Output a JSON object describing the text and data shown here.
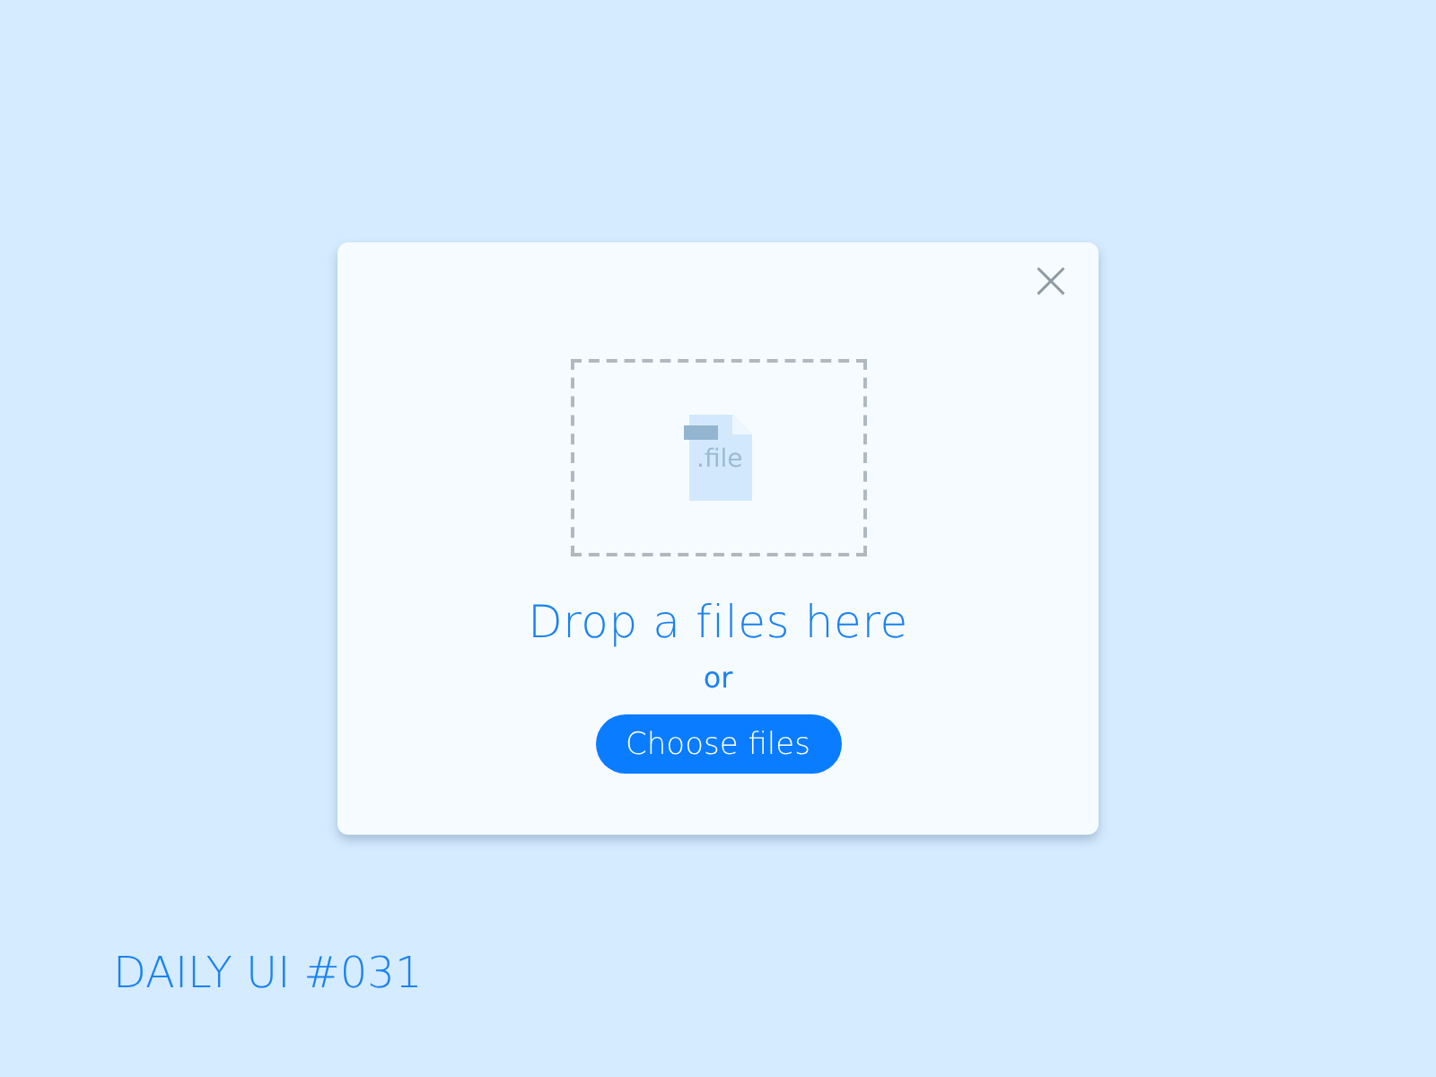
{
  "dialog": {
    "close_icon": "×",
    "file_extension": ".file",
    "heading": "Drop a files here",
    "separator": "or",
    "button": "Choose files"
  },
  "footer": {
    "label": "DAILY UI #031"
  }
}
